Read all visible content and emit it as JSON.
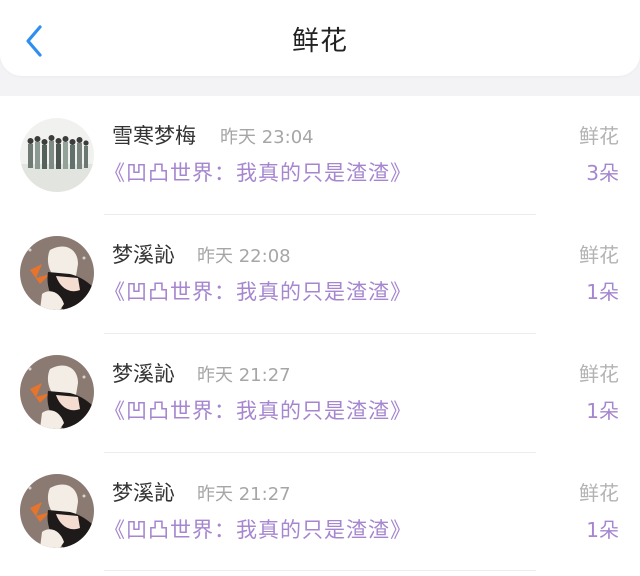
{
  "header": {
    "title": "鲜花",
    "back_icon": "chevron-left-icon",
    "accent_color": "#2f8ff0"
  },
  "colors": {
    "book_title": "#a586cf",
    "time": "#a6a6a6",
    "name": "#333333"
  },
  "records": [
    {
      "name": "雪寒梦梅",
      "time": "昨天 23:04",
      "book": "《凹凸世界：我真的只是渣渣》",
      "gift_type": "鲜花",
      "count": "3朵",
      "avatar": "group-photo-avatar"
    },
    {
      "name": "梦溪訫",
      "time": "昨天 22:08",
      "book": "《凹凸世界：我真的只是渣渣》",
      "gift_type": "鲜花",
      "count": "1朵",
      "avatar": "anime-girl-avatar"
    },
    {
      "name": "梦溪訫",
      "time": "昨天 21:27",
      "book": "《凹凸世界：我真的只是渣渣》",
      "gift_type": "鲜花",
      "count": "1朵",
      "avatar": "anime-girl-avatar"
    },
    {
      "name": "梦溪訫",
      "time": "昨天 21:27",
      "book": "《凹凸世界：我真的只是渣渣》",
      "gift_type": "鲜花",
      "count": "1朵",
      "avatar": "anime-girl-avatar"
    }
  ]
}
